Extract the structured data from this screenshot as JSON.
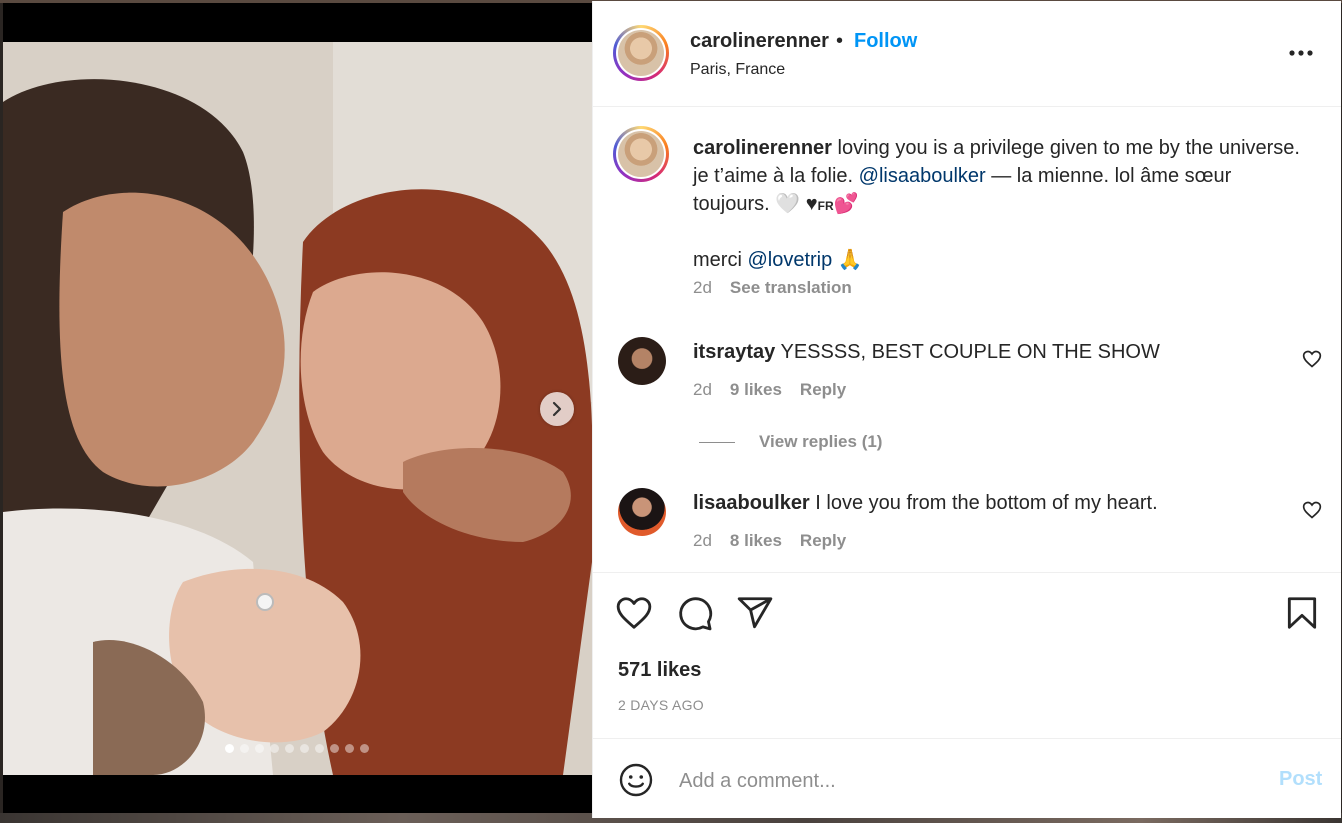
{
  "post": {
    "username": "carolinerenner",
    "follow_label": "Follow",
    "separator": "•",
    "location": "Paris, France",
    "more_icon": "more-horizontal-icon"
  },
  "caption": {
    "username": "carolinerenner",
    "text_1": " loving you is a privilege given to me by the universe. je t’aime à la folie. ",
    "mention_1": "@lisaaboulker",
    "text_2": " — la mienne. lol âme sœur toujours. 🤍 ",
    "flag_text": "FR",
    "text_3": "merci ",
    "mention_2": "@lovetrip",
    "age": "2d",
    "translate_label": "See translation"
  },
  "comments": [
    {
      "username": "itsraytay",
      "text": " YESSSS, BEST COUPLE ON THE SHOW",
      "age": "2d",
      "likes": "9 likes",
      "reply_label": "Reply"
    },
    {
      "username": "lisaaboulker",
      "text": " I love you from the bottom of my heart.",
      "age": "2d",
      "likes": "8 likes",
      "reply_label": "Reply"
    }
  ],
  "view_replies": "View replies (1)",
  "actions": {
    "likes": "571 likes",
    "date": "2 DAYS AGO",
    "icons": [
      "heart-icon",
      "comment-icon",
      "share-icon",
      "bookmark-icon"
    ]
  },
  "add_comment": {
    "placeholder": "Add a comment...",
    "post_label": "Post"
  },
  "carousel": {
    "total": 10,
    "active_index": 0
  },
  "colors": {
    "follow": "#0095f6",
    "mention": "#00376b",
    "muted": "#8e8e8e",
    "post_disabled": "#b2dffc"
  }
}
